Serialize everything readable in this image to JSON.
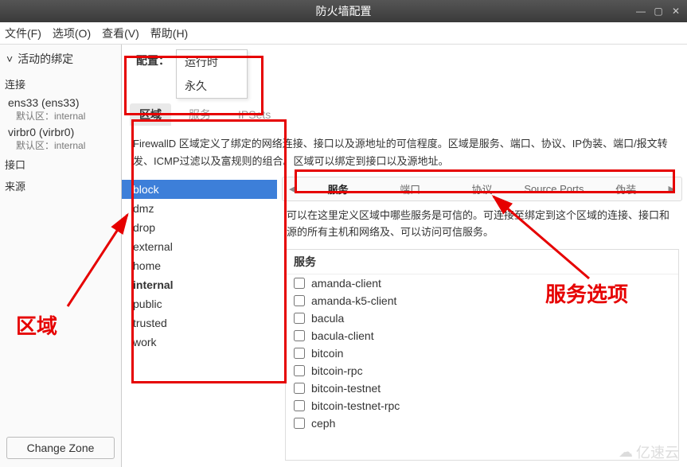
{
  "window": {
    "title": "防火墙配置"
  },
  "menu": {
    "file": "文件(F)",
    "options": "选项(O)",
    "view": "查看(V)",
    "help": "帮助(H)"
  },
  "left": {
    "active_bindings": "活动的绑定",
    "connections": "连接",
    "conn": [
      {
        "name": "ens33 (ens33)",
        "sub": "默认区：internal"
      },
      {
        "name": "virbr0 (virbr0)",
        "sub": "默认区：internal"
      }
    ],
    "interfaces": "接口",
    "sources": "来源",
    "change_zone": "Change Zone"
  },
  "config": {
    "label": "配置：",
    "opt_runtime": "运行时",
    "opt_permanent": "永久"
  },
  "maintabs": {
    "zone": "区域",
    "services": "服务",
    "ipsets": "IPSets"
  },
  "zone_desc": "FirewallD 区域定义了绑定的网络连接、接口以及源地址的可信程度。区域是服务、端口、协议、IP伪装、端口/报文转发、ICMP过滤以及富规则的组合。区域可以绑定到接口以及源地址。",
  "zones": [
    "block",
    "dmz",
    "drop",
    "external",
    "home",
    "internal",
    "public",
    "trusted",
    "work"
  ],
  "subtabs": {
    "service": "服务",
    "ports": "端口",
    "protocol": "协议",
    "source_ports": "Source Ports",
    "masq": "伪装"
  },
  "svc_desc": "可以在这里定义区域中哪些服务是可信的。可连接至绑定到这个区域的连接、接口和源的所有主机和网络及、可以访问可信服务。",
  "svc_header": "服务",
  "services": [
    "amanda-client",
    "amanda-k5-client",
    "bacula",
    "bacula-client",
    "bitcoin",
    "bitcoin-rpc",
    "bitcoin-testnet",
    "bitcoin-testnet-rpc",
    "ceph"
  ],
  "ann": {
    "zone": "区域",
    "svcopt": "服务选项"
  },
  "watermark": "亿速云"
}
